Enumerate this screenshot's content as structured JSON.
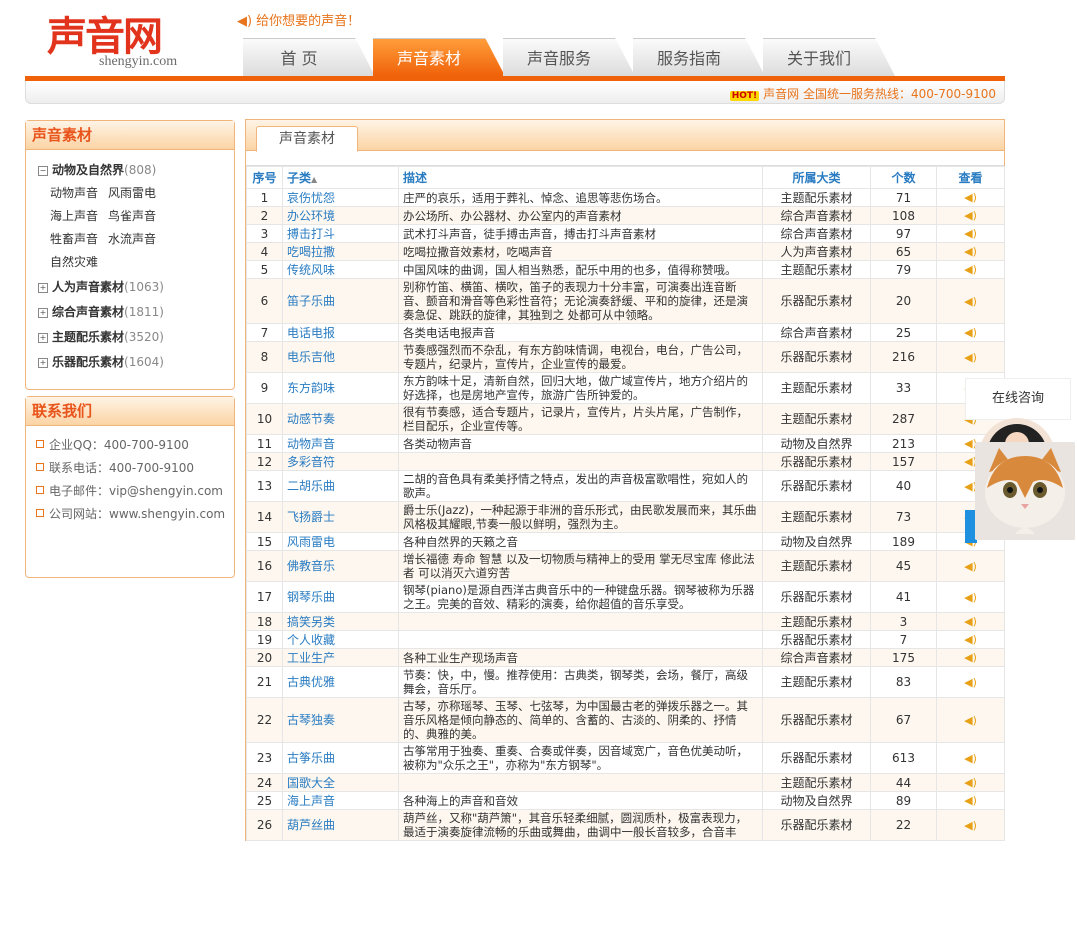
{
  "brand": {
    "cn": "声音网",
    "en": "shengyin.com",
    "slogan": "给你想要的声音！"
  },
  "nav": [
    {
      "label": "首 页",
      "active": false
    },
    {
      "label": "声音素材",
      "active": true
    },
    {
      "label": "声音服务",
      "active": false
    },
    {
      "label": "服务指南",
      "active": false
    },
    {
      "label": "关于我们",
      "active": false
    }
  ],
  "hotline": {
    "badge": "HOT!",
    "text": "声音网 全国统一服务热线：400-700-9100"
  },
  "sidebar": {
    "title": "声音素材",
    "categories": [
      {
        "name": "动物及自然界",
        "count": "(808)",
        "expanded": true,
        "subs": [
          "动物声音",
          "风雨雷电",
          "海上声音",
          "鸟雀声音",
          "牲畜声音",
          "水流声音",
          "自然灾难"
        ]
      },
      {
        "name": "人为声音素材",
        "count": "(1063)",
        "expanded": false
      },
      {
        "name": "综合声音素材",
        "count": "(1811)",
        "expanded": false
      },
      {
        "name": "主题配乐素材",
        "count": "(3520)",
        "expanded": false
      },
      {
        "name": "乐器配乐素材",
        "count": "(1604)",
        "expanded": false
      }
    ]
  },
  "contact": {
    "title": "联系我们",
    "items": [
      "企业QQ：400-700-9100",
      "联系电话：400-700-9100",
      "电子邮件：vip@shengyin.com",
      "公司网站：www.shengyin.com"
    ]
  },
  "main": {
    "tab": "声音素材",
    "columns": [
      "序号",
      "子类",
      "描述",
      "所属大类",
      "个数",
      "查看"
    ],
    "rows": [
      [
        "1",
        "哀伤忧怨",
        "庄严的哀乐，适用于葬礼、悼念、追思等悲伤场合。",
        "主题配乐素材",
        "71"
      ],
      [
        "2",
        "办公环境",
        "办公场所、办公器材、办公室内的声音素材",
        "综合声音素材",
        "108"
      ],
      [
        "3",
        "搏击打斗",
        "武术打斗声音，徒手搏击声音，搏击打斗声音素材",
        "综合声音素材",
        "97"
      ],
      [
        "4",
        "吃喝拉撒",
        "吃喝拉撒音效素材，吃喝声音",
        "人为声音素材",
        "65"
      ],
      [
        "5",
        "传统风味",
        "中国风味的曲调，国人相当熟悉，配乐中用的也多，值得称赞哦。",
        "主题配乐素材",
        "79"
      ],
      [
        "6",
        "笛子乐曲",
        "别称竹笛、横笛、横吹，笛子的表现力十分丰富，可演奏出连音断音、颤音和滑音等色彩性音符；无论演奏舒缓、平和的旋律，还是演奏急促、跳跃的旋律，其独到之 处都可从中领略。",
        "乐器配乐素材",
        "20"
      ],
      [
        "7",
        "电话电报",
        "各类电话电报声音",
        "综合声音素材",
        "25"
      ],
      [
        "8",
        "电乐吉他",
        "节奏感强烈而不杂乱，有东方韵味情调，电视台，电台，广告公司，专题片，纪录片，宣传片，企业宣传的最爱。",
        "乐器配乐素材",
        "216"
      ],
      [
        "9",
        "东方韵味",
        "东方韵味十足，清新自然，回归大地，做广域宣传片，地方介绍片的好选择，也是房地产宣传，旅游广告所钟爱的。",
        "主题配乐素材",
        "33"
      ],
      [
        "10",
        "动感节奏",
        "很有节奏感，适合专题片，记录片，宣传片，片头片尾，广告制作，栏目配乐，企业宣传等。",
        "主题配乐素材",
        "287"
      ],
      [
        "11",
        "动物声音",
        "各类动物声音",
        "动物及自然界",
        "213"
      ],
      [
        "12",
        "多彩音符",
        "",
        "乐器配乐素材",
        "157"
      ],
      [
        "13",
        "二胡乐曲",
        "二胡的音色具有柔美抒情之特点，发出的声音极富歌唱性，宛如人的歌声。",
        "乐器配乐素材",
        "40"
      ],
      [
        "14",
        "飞扬爵士",
        "爵士乐(Jazz)，一种起源于非洲的音乐形式，由民歌发展而来，其乐曲风格极其耀眼,节奏一般以鲜明，强烈为主。",
        "主题配乐素材",
        "73"
      ],
      [
        "15",
        "风雨雷电",
        "各种自然界的天籁之音",
        "动物及自然界",
        "189"
      ],
      [
        "16",
        "佛教音乐",
        "增长福德 寿命 智慧 以及一切物质与精神上的受用 掌无尽宝库 修此法者 可以消灭六道穷苦",
        "主题配乐素材",
        "45"
      ],
      [
        "17",
        "钢琴乐曲",
        "钢琴(piano)是源自西洋古典音乐中的一种键盘乐器。钢琴被称为乐器之王。完美的音效、精彩的演奏，给你超值的音乐享受。",
        "乐器配乐素材",
        "41"
      ],
      [
        "18",
        "搞笑另类",
        "",
        "主题配乐素材",
        "3"
      ],
      [
        "19",
        "个人收藏",
        "",
        "乐器配乐素材",
        "7"
      ],
      [
        "20",
        "工业生产",
        "各种工业生产现场声音",
        "综合声音素材",
        "175"
      ],
      [
        "21",
        "古典优雅",
        "节奏：快，中，慢。推荐使用：古典类，钢琴类，会场，餐厅，高级舞会，音乐厅。",
        "主题配乐素材",
        "83"
      ],
      [
        "22",
        "古琴独奏",
        "古琴，亦称瑶琴、玉琴、七弦琴，为中国最古老的弹拨乐器之一。其音乐风格是倾向静态的、简单的、含蓄的、古淡的、阴柔的、抒情的、典雅的美。",
        "乐器配乐素材",
        "67"
      ],
      [
        "23",
        "古筝乐曲",
        "古筝常用于独奏、重奏、合奏或伴奏，因音域宽广，音色优美动听，被称为\"众乐之王\"，亦称为\"东方钢琴\"。",
        "乐器配乐素材",
        "613"
      ],
      [
        "24",
        "国歌大全",
        "",
        "主题配乐素材",
        "44"
      ],
      [
        "25",
        "海上声音",
        "各种海上的声音和音效",
        "动物及自然界",
        "89"
      ],
      [
        "26",
        "葫芦丝曲",
        "葫芦丝，又称\"葫芦箫\"，其音乐轻柔细腻，圆润质朴，极富表现力，最适于演奏旋律流畅的乐曲或舞曲，曲调中一般长音较多，合音丰",
        "乐器配乐素材",
        "22"
      ]
    ]
  },
  "online": {
    "title": "在线咨询"
  }
}
